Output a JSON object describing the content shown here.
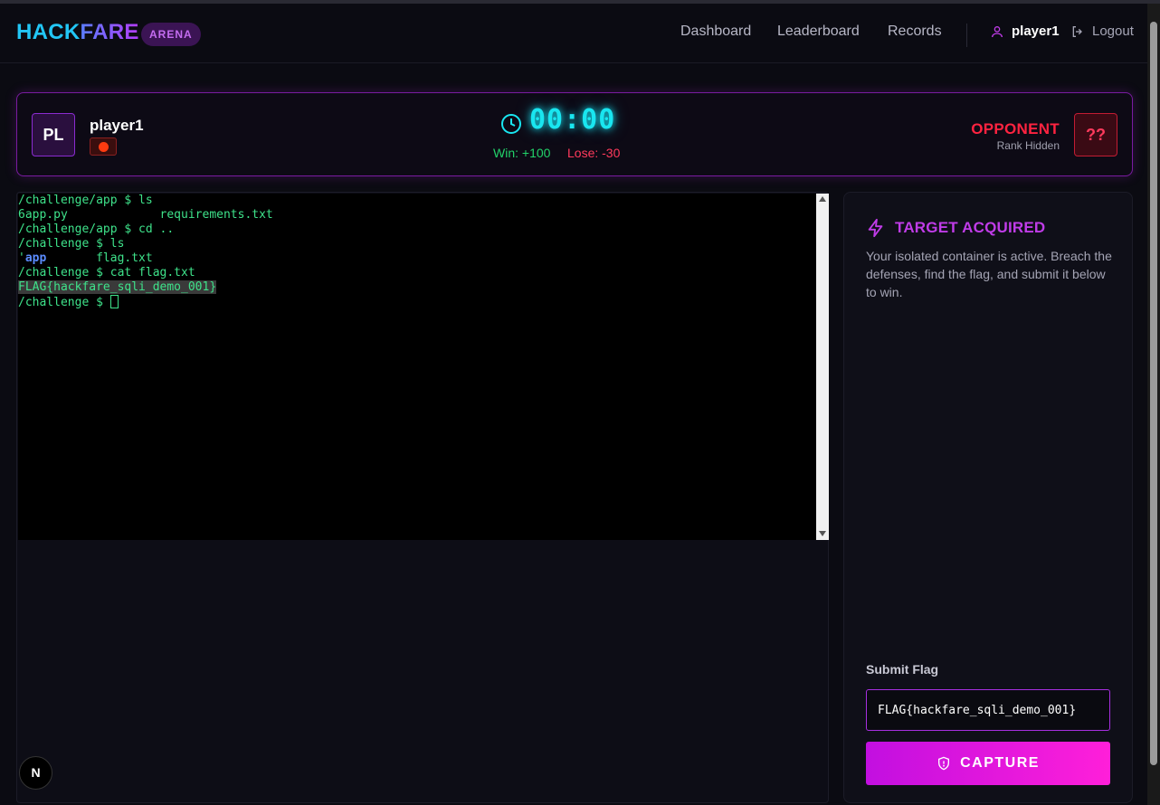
{
  "brand": {
    "part1": "HACK",
    "part2": "FARE",
    "badge": "ARENA"
  },
  "nav": {
    "dashboard": "Dashboard",
    "leaderboard": "Leaderboard",
    "records": "Records"
  },
  "user": {
    "name": "player1",
    "logout": "Logout"
  },
  "match": {
    "player_initials": "PL",
    "player_name": "player1",
    "timer": "00:00",
    "win": "Win: +100",
    "lose": "Lose: -30",
    "opponent_label": "OPPONENT",
    "opponent_rank": "Rank Hidden",
    "opponent_avatar": "??"
  },
  "terminal": {
    "lines": [
      "/challenge/app $ ls",
      "6app.py             requirements.txt",
      "/challenge/app $ cd ..",
      "/challenge $ ls",
      "'app       flag.txt",
      "/challenge $ cat flag.txt",
      "FLAG{hackfare_sqli_demo_001}",
      "/challenge $ "
    ]
  },
  "side": {
    "title": "TARGET ACQUIRED",
    "description": "Your isolated container is active. Breach the defenses, find the flag, and submit it below to win.",
    "flag_label": "Submit Flag",
    "flag_value": "FLAG{hackfare_sqli_demo_001}",
    "capture_label": "CAPTURE"
  },
  "dev_badge": "N",
  "colors": {
    "accent": "#c03ce8",
    "cyan": "#19e6f0",
    "danger": "#ff2340",
    "success": "#22d36a"
  }
}
